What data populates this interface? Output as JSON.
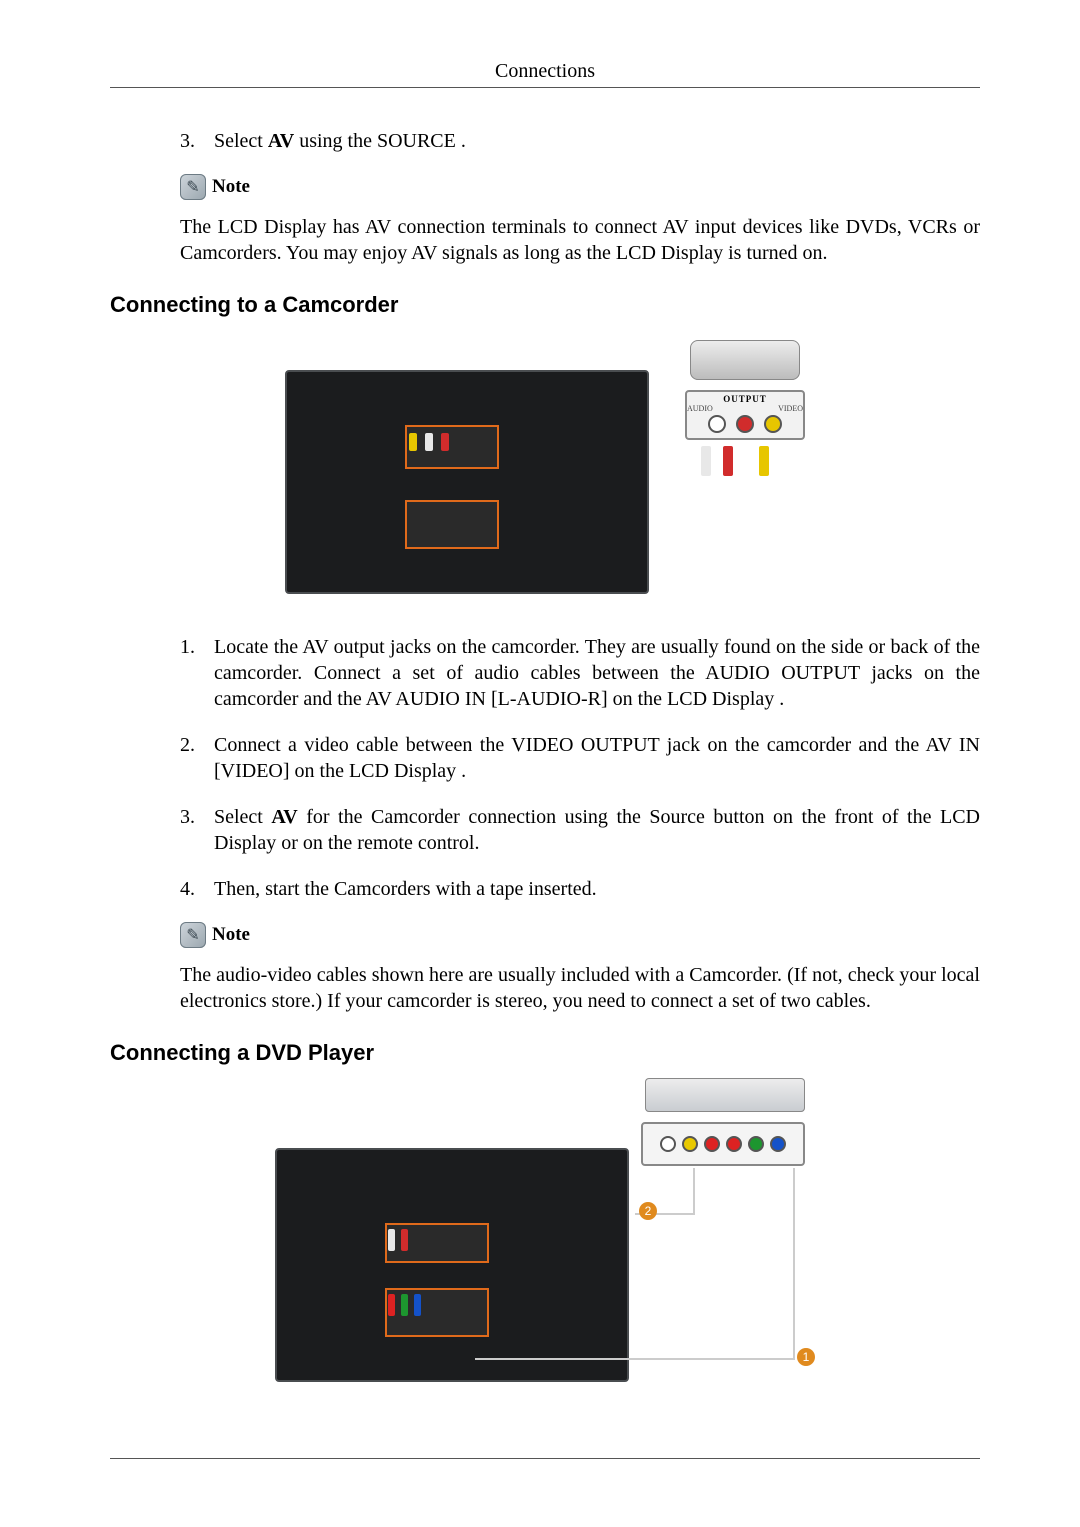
{
  "header": {
    "title": "Connections"
  },
  "step3": {
    "number": "3.",
    "prefix": "Select ",
    "bold": "AV",
    "suffix": " using the SOURCE ."
  },
  "note1": {
    "label": "Note",
    "text": "The LCD Display has AV connection terminals to connect AV input devices like DVDs, VCRs or Camcorders. You may enjoy AV signals as long as the LCD Display is turned on."
  },
  "section_cam": {
    "title": "Connecting to a Camcorder"
  },
  "figure_cam": {
    "output_title": "OUTPUT",
    "output_audio": "AUDIO",
    "output_video": "VIDEO"
  },
  "cam_steps": [
    {
      "n": "1.",
      "t": "Locate the AV output jacks on the camcorder. They are usually found on the side or back of the camcorder. Connect a set of audio cables between the AUDIO OUTPUT jacks on the camcorder and the AV AUDIO IN [L-AUDIO-R] on the LCD Display ."
    },
    {
      "n": "2.",
      "t": "Connect a video cable between the VIDEO OUTPUT jack on the camcorder and the AV IN [VIDEO] on the LCD Display ."
    },
    {
      "n": "3.",
      "prefix": "Select ",
      "bold": "AV",
      "suffix": " for the Camcorder connection using the Source button on the front of the LCD Display or on the remote control."
    },
    {
      "n": "4.",
      "t": "Then, start the Camcorders with a tape inserted."
    }
  ],
  "note2": {
    "label": "Note",
    "text": "The audio-video cables shown here are usually included with a Camcorder. (If not, check your local electronics store.) If your camcorder is stereo, you need to connect a set of two cables."
  },
  "section_dvd": {
    "title": "Connecting a DVD Player"
  },
  "figure_dvd": {
    "callout1": "1",
    "callout2": "2"
  }
}
